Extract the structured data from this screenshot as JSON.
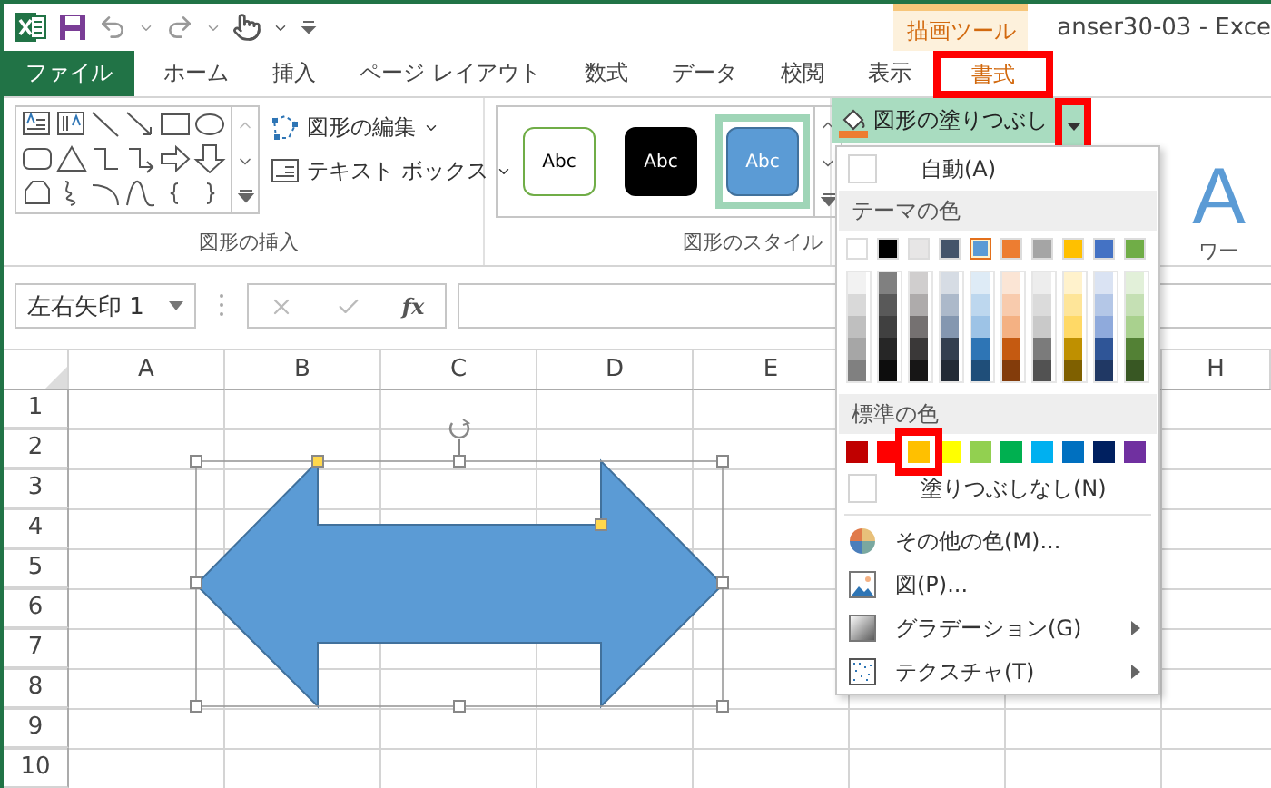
{
  "title_bar": {
    "contextual_label": "描画ツール",
    "title": "anser30-03 - Exce"
  },
  "tabs": [
    {
      "label": "ファイル",
      "kind": "file",
      "selected": false,
      "highlighted": false
    },
    {
      "label": "ホーム",
      "kind": "normal",
      "selected": false,
      "highlighted": false
    },
    {
      "label": "挿入",
      "kind": "normal",
      "selected": false,
      "highlighted": false
    },
    {
      "label": "ページ レイアウト",
      "kind": "normal",
      "selected": false,
      "highlighted": false
    },
    {
      "label": "数式",
      "kind": "normal",
      "selected": false,
      "highlighted": false
    },
    {
      "label": "データ",
      "kind": "normal",
      "selected": false,
      "highlighted": false
    },
    {
      "label": "校閲",
      "kind": "normal",
      "selected": false,
      "highlighted": false
    },
    {
      "label": "表示",
      "kind": "normal",
      "selected": false,
      "highlighted": false
    },
    {
      "label": "書式",
      "kind": "contextual",
      "selected": true,
      "highlighted": true
    }
  ],
  "ribbon": {
    "insert_group": {
      "label": "図形の挿入",
      "buttons": [
        "図形の編集",
        "テキスト ボックス"
      ]
    },
    "style_group": {
      "label": "図形のスタイル",
      "styles": [
        {
          "label": "Abc",
          "kind": "outline",
          "selected": false
        },
        {
          "label": "Abc",
          "kind": "dark",
          "selected": false
        },
        {
          "label": "Abc",
          "kind": "blue",
          "selected": true
        }
      ]
    },
    "fill_button": {
      "label": "図形の塗りつぶし",
      "highlighted": true
    },
    "wordart_preview": "A",
    "wordart_group_label": "ワー"
  },
  "formula_bar": {
    "name_box": "左右矢印 1",
    "function_label": "fx"
  },
  "sheet": {
    "columns": [
      "A",
      "B",
      "C",
      "D",
      "E"
    ],
    "columns_right": [
      "H"
    ],
    "rows": [
      "1",
      "2",
      "3",
      "4",
      "5",
      "6",
      "7",
      "8",
      "9",
      "10"
    ]
  },
  "fill_menu": {
    "automatic": "自動(A)",
    "theme_header": "テーマの色",
    "theme_colors": [
      {
        "color": "#ffffff",
        "selected": false,
        "shades": [
          {
            "color": "#f2f2f2"
          },
          {
            "color": "#d9d9d9"
          },
          {
            "color": "#bfbfbf"
          },
          {
            "color": "#a6a6a6"
          },
          {
            "color": "#808080"
          }
        ]
      },
      {
        "color": "#000000",
        "selected": false,
        "shades": [
          {
            "color": "#808080"
          },
          {
            "color": "#595959"
          },
          {
            "color": "#404040"
          },
          {
            "color": "#262626"
          },
          {
            "color": "#0d0d0d"
          }
        ]
      },
      {
        "color": "#e7e6e6",
        "selected": false,
        "shades": [
          {
            "color": "#d0cece"
          },
          {
            "color": "#aeabab"
          },
          {
            "color": "#757171"
          },
          {
            "color": "#3a3838"
          },
          {
            "color": "#171616"
          }
        ]
      },
      {
        "color": "#44546a",
        "selected": false,
        "shades": [
          {
            "color": "#d6dce4"
          },
          {
            "color": "#acb9ca"
          },
          {
            "color": "#8497b0"
          },
          {
            "color": "#333f4f"
          },
          {
            "color": "#222a35"
          }
        ]
      },
      {
        "color": "#5b9bd5",
        "selected": true,
        "shades": [
          {
            "color": "#deebf6"
          },
          {
            "color": "#bdd7ee"
          },
          {
            "color": "#9dc3e6"
          },
          {
            "color": "#2e75b5"
          },
          {
            "color": "#1f4e79"
          }
        ]
      },
      {
        "color": "#ed7d31",
        "selected": false,
        "shades": [
          {
            "color": "#fbe5d5"
          },
          {
            "color": "#f8cbad"
          },
          {
            "color": "#f4b183"
          },
          {
            "color": "#c55a11"
          },
          {
            "color": "#833c0b"
          }
        ]
      },
      {
        "color": "#a5a5a5",
        "selected": false,
        "shades": [
          {
            "color": "#ededed"
          },
          {
            "color": "#dbdbdb"
          },
          {
            "color": "#c9c9c9"
          },
          {
            "color": "#7b7b7b"
          },
          {
            "color": "#525252"
          }
        ]
      },
      {
        "color": "#ffc000",
        "selected": false,
        "shades": [
          {
            "color": "#fff2cc"
          },
          {
            "color": "#fee599"
          },
          {
            "color": "#ffd966"
          },
          {
            "color": "#bf9000"
          },
          {
            "color": "#7f6000"
          }
        ]
      },
      {
        "color": "#4472c4",
        "selected": false,
        "shades": [
          {
            "color": "#dae3f3"
          },
          {
            "color": "#b4c7e7"
          },
          {
            "color": "#8faadc"
          },
          {
            "color": "#2f5597"
          },
          {
            "color": "#203864"
          }
        ]
      },
      {
        "color": "#70ad47",
        "selected": false,
        "shades": [
          {
            "color": "#e2f0d9"
          },
          {
            "color": "#c5e0b4"
          },
          {
            "color": "#a9d18e"
          },
          {
            "color": "#538135"
          },
          {
            "color": "#385723"
          }
        ]
      }
    ],
    "standard_header": "標準の色",
    "standard_colors": [
      {
        "color": "#c00000",
        "highlighted": false
      },
      {
        "color": "#ff0000",
        "highlighted": false
      },
      {
        "color": "#ffc000",
        "highlighted": true
      },
      {
        "color": "#ffff00",
        "highlighted": false
      },
      {
        "color": "#92d050",
        "highlighted": false
      },
      {
        "color": "#00b050",
        "highlighted": false
      },
      {
        "color": "#00b0f0",
        "highlighted": false
      },
      {
        "color": "#0070c0",
        "highlighted": false
      },
      {
        "color": "#002060",
        "highlighted": false
      },
      {
        "color": "#7030a0",
        "highlighted": false
      }
    ],
    "no_fill": "塗りつぶしなし(N)",
    "items": [
      {
        "label": "その他の色(M)...",
        "kind": "colors",
        "submenu": false
      },
      {
        "label": "図(P)...",
        "kind": "picture",
        "submenu": false
      },
      {
        "label": "グラデーション(G)",
        "kind": "gradient",
        "submenu": true
      },
      {
        "label": "テクスチャ(T)",
        "kind": "texture",
        "submenu": true
      }
    ]
  }
}
